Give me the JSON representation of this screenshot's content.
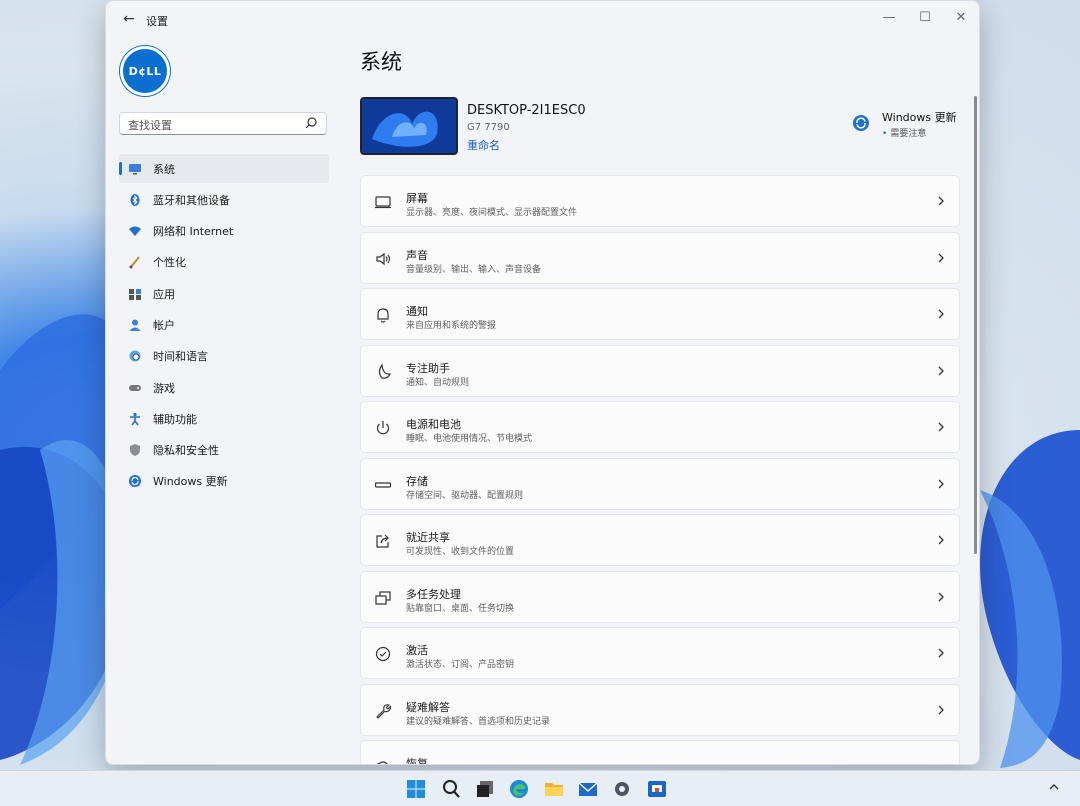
{
  "window": {
    "title": "设置",
    "back_icon": "back-arrow-icon",
    "controls": [
      "minimize",
      "maximize",
      "close"
    ]
  },
  "logo": {
    "text": "D¢LL"
  },
  "search": {
    "placeholder": "查找设置"
  },
  "nav": {
    "items": [
      {
        "label": "系统",
        "icon": "monitor-icon",
        "active": true
      },
      {
        "label": "蓝牙和其他设备",
        "icon": "bluetooth-icon"
      },
      {
        "label": "网络和 Internet",
        "icon": "wifi-icon"
      },
      {
        "label": "个性化",
        "icon": "brush-icon"
      },
      {
        "label": "应用",
        "icon": "apps-icon"
      },
      {
        "label": "帐户",
        "icon": "person-icon"
      },
      {
        "label": "时间和语言",
        "icon": "globe-clock-icon"
      },
      {
        "label": "游戏",
        "icon": "gamepad-icon"
      },
      {
        "label": "辅助功能",
        "icon": "accessibility-icon"
      },
      {
        "label": "隐私和安全性",
        "icon": "shield-icon"
      },
      {
        "label": "Windows 更新",
        "icon": "update-icon"
      }
    ]
  },
  "main": {
    "title": "系统",
    "device": {
      "name": "DESKTOP-2I1ESC0",
      "model": "G7 7790",
      "rename_label": "重命名"
    },
    "windows_update": {
      "title": "Windows 更新",
      "status": "需要注意"
    },
    "cards": [
      {
        "title": "屏幕",
        "subtitle": "显示器、亮度、夜间模式、显示器配置文件",
        "icon": "display-icon"
      },
      {
        "title": "声音",
        "subtitle": "音量级别、输出、输入、声音设备",
        "icon": "speaker-icon"
      },
      {
        "title": "通知",
        "subtitle": "来自应用和系统的警报",
        "icon": "bell-icon"
      },
      {
        "title": "专注助手",
        "subtitle": "通知、自动规则",
        "icon": "moon-icon"
      },
      {
        "title": "电源和电池",
        "subtitle": "睡眠、电池使用情况、节电模式",
        "icon": "power-icon"
      },
      {
        "title": "存储",
        "subtitle": "存储空间、驱动器、配置规则",
        "icon": "storage-icon"
      },
      {
        "title": "就近共享",
        "subtitle": "可发现性、收到文件的位置",
        "icon": "share-icon"
      },
      {
        "title": "多任务处理",
        "subtitle": "贴靠窗口、桌面、任务切换",
        "icon": "multitask-icon"
      },
      {
        "title": "激活",
        "subtitle": "激活状态、订阅、产品密钥",
        "icon": "check-circle-icon"
      },
      {
        "title": "疑难解答",
        "subtitle": "建议的疑难解答、首选项和历史记录",
        "icon": "wrench-icon"
      },
      {
        "title": "恢复",
        "subtitle": "",
        "icon": "recovery-icon"
      }
    ]
  },
  "taskbar": {
    "icons": [
      "start-icon",
      "search-icon",
      "task-view-icon",
      "edge-icon",
      "file-explorer-icon",
      "mail-icon",
      "settings-icon",
      "store-icon"
    ],
    "tray_icon": "chevron-up-icon"
  },
  "colors": {
    "accent": "#1f6fcf",
    "window_bg": "#f2f4f8",
    "card_bg": "#fbfbfc"
  }
}
